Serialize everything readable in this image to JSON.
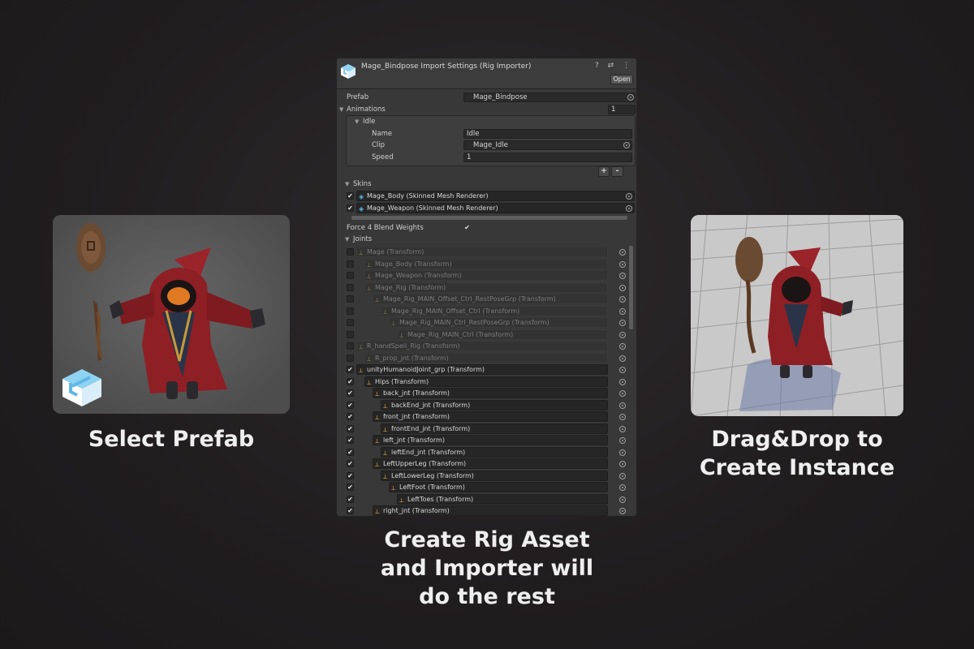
{
  "captions": {
    "left": "Select Prefab",
    "right_line1": "Drag&Drop to",
    "right_line2": "Create Instance",
    "mid_line1": "Create Rig Asset",
    "mid_line2": "and Importer will",
    "mid_line3": "do the rest"
  },
  "inspector": {
    "title": "Mage_Bindpose Import Settings (Rig Importer)",
    "header_icons": "? ⇄ ⋮",
    "open_label": "Open",
    "prefab_label": "Prefab",
    "prefab_value": "Mage_Bindpose",
    "animations_label": "Animations",
    "animations_count": "1",
    "idle_label": "Idle",
    "name_label": "Name",
    "name_value": "Idle",
    "clip_label": "Clip",
    "clip_value": "Mage_Idle",
    "speed_label": "Speed",
    "speed_value": "1",
    "add_label": "+",
    "remove_label": "-",
    "skins_label": "Skins",
    "skins": [
      "Mage_Body (Skinned Mesh Renderer)",
      "Mage_Weapon (Skinned Mesh Renderer)"
    ],
    "blend_label": "Force 4 Blend Weights",
    "joints_label": "Joints",
    "joints": [
      {
        "name": "Mage (Transform)",
        "checked": false
      },
      {
        "name": "Mage_Body (Transform)",
        "checked": false
      },
      {
        "name": "Mage_Weapon (Transform)",
        "checked": false
      },
      {
        "name": "Mage_Rig (Transform)",
        "checked": false
      },
      {
        "name": "Mage_Rig_MAIN_Offset_Ctrl_RestPoseGrp (Transform)",
        "checked": false
      },
      {
        "name": "Mage_Rig_MAIN_Offset_Ctrl (Transform)",
        "checked": false
      },
      {
        "name": "Mage_Rig_MAIN_Ctrl_RestPoseGrp (Transform)",
        "checked": false
      },
      {
        "name": "Mage_Rig_MAIN_Ctrl (Transform)",
        "checked": false
      },
      {
        "name": "R_handSpell_Rig (Transform)",
        "checked": false
      },
      {
        "name": "R_prop_jnt (Transform)",
        "checked": false
      },
      {
        "name": "unityHumanoidJoint_grp (Transform)",
        "checked": true
      },
      {
        "name": "Hips (Transform)",
        "checked": true
      },
      {
        "name": "back_jnt (Transform)",
        "checked": true
      },
      {
        "name": "backEnd_jnt (Transform)",
        "checked": true
      },
      {
        "name": "front_jnt (Transform)",
        "checked": true
      },
      {
        "name": "frontEnd_jnt (Transform)",
        "checked": true
      },
      {
        "name": "left_jnt (Transform)",
        "checked": true
      },
      {
        "name": "leftEnd_jnt (Transform)",
        "checked": true
      },
      {
        "name": "LeftUpperLeg (Transform)",
        "checked": true
      },
      {
        "name": "LeftLowerLeg (Transform)",
        "checked": true
      },
      {
        "name": "LeftFoot (Transform)",
        "checked": true
      },
      {
        "name": "LeftToes (Transform)",
        "checked": true
      },
      {
        "name": "right_jnt (Transform)",
        "checked": true
      }
    ]
  },
  "colors": {
    "accent_icon": "#5fb8e6",
    "robe": "#8e1f24",
    "bone_icon": "#e0a94a"
  }
}
